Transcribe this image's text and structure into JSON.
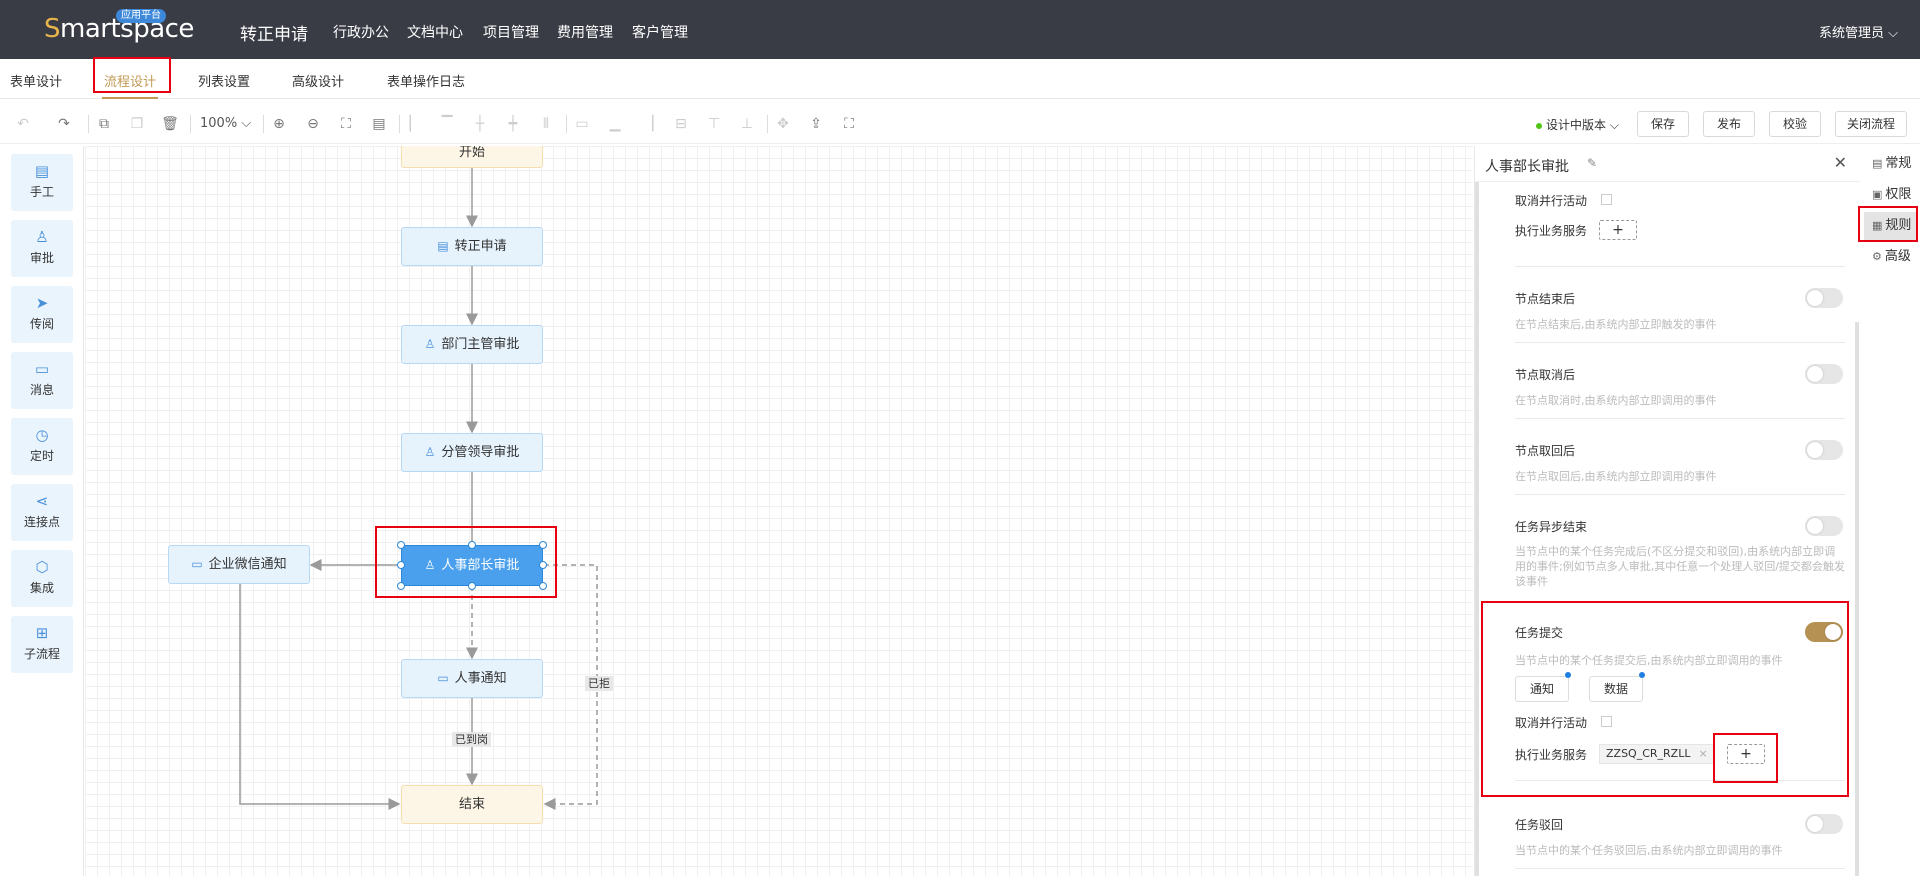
{
  "header": {
    "logo_text": "Smartspace",
    "logo_badge": "应用平台",
    "title": "转正申请",
    "menu": [
      "行政办公",
      "文档中心",
      "项目管理",
      "费用管理",
      "客户管理"
    ],
    "user": "系统管理员"
  },
  "tabs": [
    "表单设计",
    "流程设计",
    "列表设置",
    "高级设计",
    "表单操作日志"
  ],
  "toolbar": {
    "zoom": "100%",
    "version": "设计中版本",
    "save": "保存",
    "publish": "发布",
    "validate": "校验",
    "close": "关闭流程"
  },
  "palette": [
    "手工",
    "审批",
    "传阅",
    "消息",
    "定时",
    "连接点",
    "集成",
    "子流程"
  ],
  "flow": {
    "nodes": {
      "start": "开始",
      "apply": "转正申请",
      "dept": "部门主管审批",
      "branch": "分管领导审批",
      "hr_head": "人事部长审批",
      "wechat": "企业微信通知",
      "hr_notice": "人事通知",
      "end": "结束"
    },
    "edge_labels": {
      "rejected": "已拒",
      "arrived": "已到岗"
    }
  },
  "panel": {
    "title": "人事部长审批",
    "cancel_parallel": "取消并行活动",
    "exec_service": "执行业务服务",
    "add": "+",
    "sections": [
      {
        "label": "节点结束后",
        "desc": "在节点结束后,由系统内部立即触发的事件",
        "on": false
      },
      {
        "label": "节点取消后",
        "desc": "在节点取消时,由系统内部立即调用的事件",
        "on": false
      },
      {
        "label": "节点取回后",
        "desc": "在节点取回后,由系统内部立即调用的事件",
        "on": false
      },
      {
        "label": "任务异步结束",
        "desc": "当节点中的某个任务完成后(不区分提交和驳回),由系统内部立即调用的事件;例如节点多人审批,其中任意一个处理人驳回/提交都会触发该事件",
        "on": false
      }
    ],
    "submit": {
      "label": "任务提交",
      "desc": "当节点中的某个任务提交后,由系统内部立即调用的事件",
      "on": true,
      "notify": "通知",
      "data": "数据",
      "service_tag": "ZZSQ_CR_RZLL",
      "tag_close": "×"
    },
    "reject": {
      "label": "任务驳回",
      "desc": "当节点中的某个任务驳回后,由系统内部立即调用的事件",
      "on": false
    }
  },
  "sidetabs": [
    "常规",
    "权限",
    "规则",
    "高级"
  ]
}
